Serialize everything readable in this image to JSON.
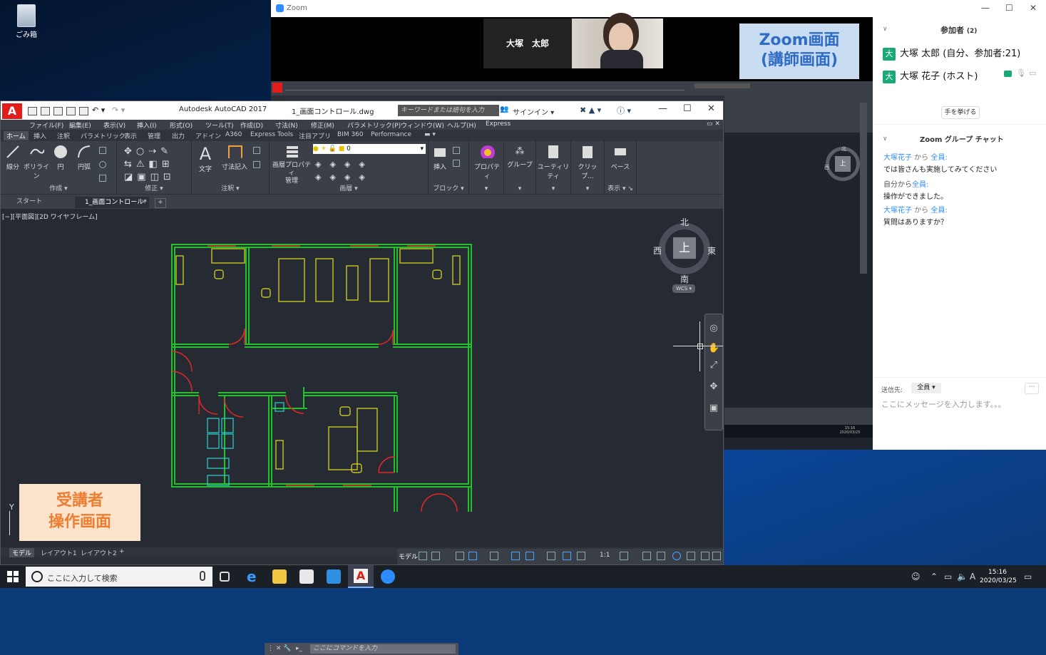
{
  "desktop": {
    "recycle_label": "ごみ箱"
  },
  "zoom": {
    "window_title": "Zoom",
    "host_tile_name": "大塚　太郎",
    "callout": "Zoom画面\n(講師画面)",
    "participants_header": "参加者",
    "participants_count": "(2)",
    "participants": [
      {
        "avatar": "大",
        "name": "大塚 太郎 (自分、参加者:21)"
      },
      {
        "avatar": "大",
        "name": "大塚 花子 (ホスト)"
      }
    ],
    "raise_hand": "手を挙げる",
    "chat_header": "Zoom グループ チャット",
    "messages": [
      {
        "from": "大塚花子",
        "mid": " から ",
        "to": "全員:",
        "text": "では皆さんも実施してみてください"
      },
      {
        "from": "自分から",
        "mid": "",
        "to": "全員:",
        "text": "操作ができました。"
      },
      {
        "from": "大塚花子",
        "mid": " から ",
        "to": "全員:",
        "text": "質問はありますか？"
      }
    ],
    "send_to_label": "送信先:",
    "send_to_value": "全員",
    "chat_placeholder": "ここにメッセージを入力します。。。",
    "more": "···",
    "shared_compass_top": "上",
    "shared_compass_n": "北",
    "shared_compass_w": "西",
    "shared_compass_e": "東",
    "shared_clock": "15:16\n2020/03/25"
  },
  "acad": {
    "app_title": "Autodesk AutoCAD 2017",
    "file_title": "1_画面コントロール.dwg",
    "search_placeholder": "キーワードまたは語句を入力",
    "signin": "サインイン",
    "menus": [
      "ファイル(F)",
      "編集(E)",
      "表示(V)",
      "挿入(I)",
      "形式(O)",
      "ツール(T)",
      "作成(D)",
      "寸法(N)",
      "修正(M)",
      "パラメトリック(P)",
      "ウィンドウ(W)",
      "ヘルプ(H)",
      "Express"
    ],
    "ribbon_tabs": [
      "ホーム",
      "挿入",
      "注釈",
      "パラメトリック",
      "表示",
      "管理",
      "出力",
      "アドイン",
      "A360",
      "Express Tools",
      "注目アプリ",
      "BIM 360",
      "Performance"
    ],
    "tools": {
      "line": "線分",
      "polyline": "ポリライン",
      "circle": "円",
      "arc": "円弧",
      "text": "文字",
      "dimension": "寸法記入",
      "layer_props": "画層プロパティ\n管理",
      "insert": "挿入",
      "properties": "プロパティ",
      "group": "グループ",
      "utilities": "ユーティリティ",
      "clipboard": "クリップ...",
      "base": "ベース"
    },
    "groups": {
      "draw": "作成 ▾",
      "modify": "修正 ▾",
      "annotation": "注釈 ▾",
      "layers": "画層 ▾",
      "block": "ブロック ▾",
      "view": "表示 ▾ ↘"
    },
    "layer_value": "0",
    "doc_tabs": {
      "start": "スタート",
      "file": "1_画面コントロール*"
    },
    "viewport_label": "[−][平面図][2D ワイヤフレーム]",
    "compass": {
      "north": "北",
      "south": "南",
      "east": "東",
      "west": "西",
      "top": "上",
      "wcs": "WCS"
    },
    "callout": "受講者\n操作画面",
    "ucs_y": "Y",
    "cmd_placeholder": "ここにコマンドを入力",
    "layout_tabs": [
      "モデル",
      "レイアウト1",
      "レイアウト2"
    ],
    "status_model": "モデル",
    "status_scale": "1:1"
  },
  "taskbar": {
    "search_placeholder": "ここに入力して検索",
    "time": "15:16",
    "date": "2020/03/25",
    "ime": "A"
  }
}
